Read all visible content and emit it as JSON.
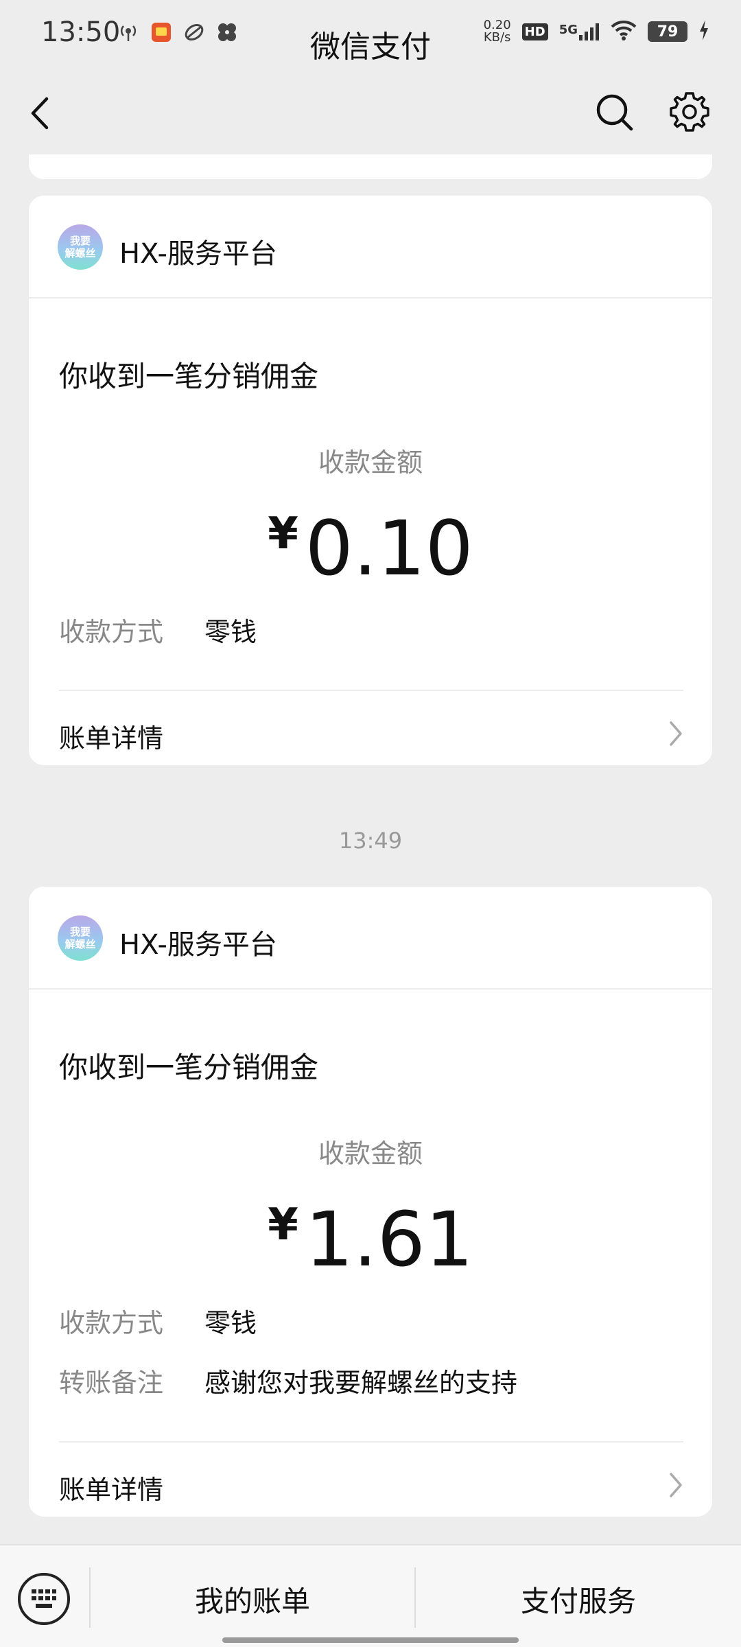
{
  "status_bar": {
    "time": "13:50",
    "speed_value": "0.20",
    "speed_unit": "KB/s",
    "hd": "HD",
    "network": "5G",
    "battery": "79"
  },
  "nav": {
    "title": "微信支付"
  },
  "cards": [
    {
      "merchant": "HX-服务平台",
      "avatar_text_1": "我要",
      "avatar_text_2": "解螺丝",
      "message": "你收到一笔分销佣金",
      "amount_label": "收款金额",
      "currency": "¥",
      "amount": "0.10",
      "method_key": "收款方式",
      "method_value": "零钱",
      "detail": "账单详情"
    },
    {
      "merchant": "HX-服务平台",
      "avatar_text_1": "我要",
      "avatar_text_2": "解螺丝",
      "message": "你收到一笔分销佣金",
      "amount_label": "收款金额",
      "currency": "¥",
      "amount": "1.61",
      "method_key": "收款方式",
      "method_value": "零钱",
      "note_key": "转账备注",
      "note_value": "感谢您对我要解螺丝的支持",
      "detail": "账单详情"
    }
  ],
  "time_separator": "13:49",
  "bottom_bar": {
    "my_bills": "我的账单",
    "pay_services": "支付服务"
  }
}
